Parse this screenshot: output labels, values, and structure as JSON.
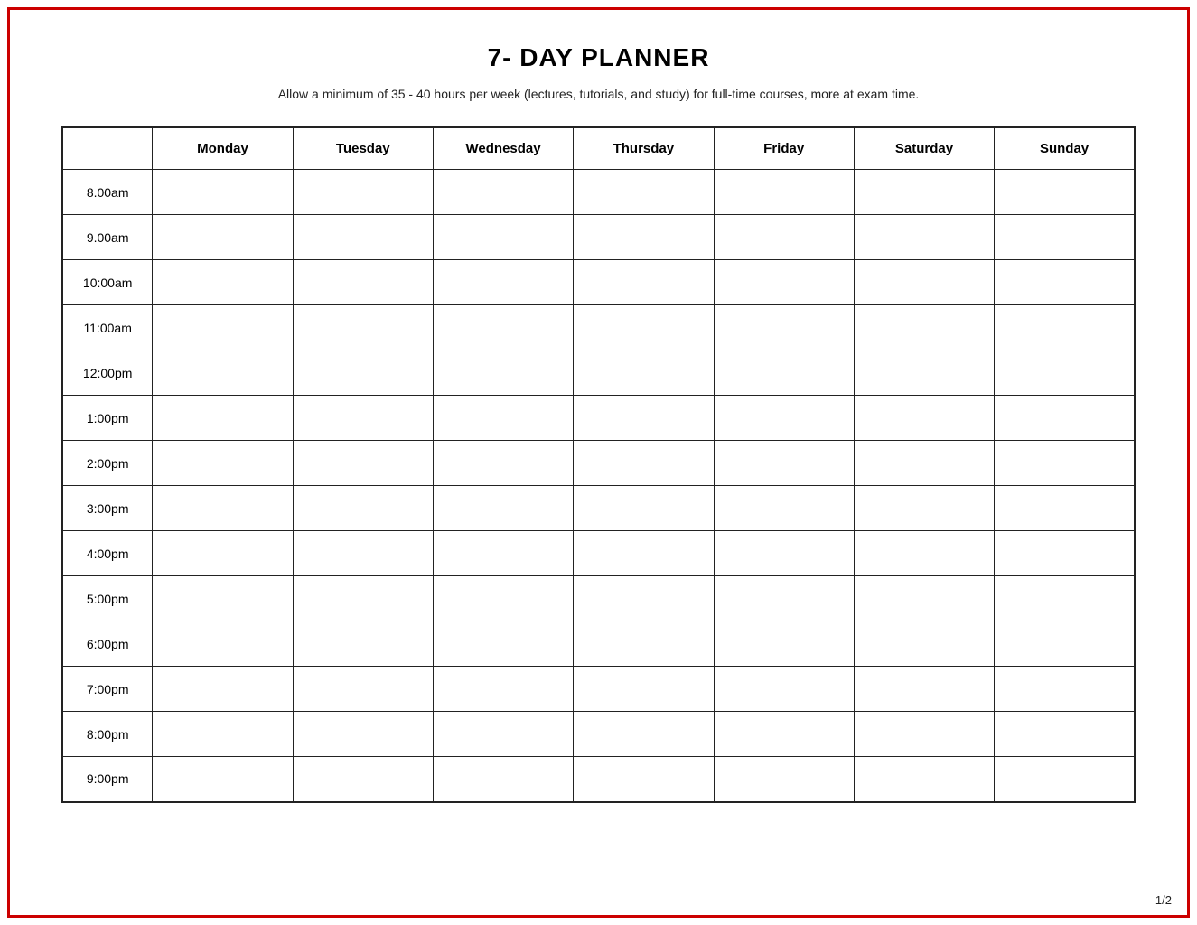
{
  "page": {
    "title": "7- DAY PLANNER",
    "subtitle": "Allow a minimum of 35 - 40 hours per week (lectures, tutorials, and study) for full-time courses, more at exam time.",
    "page_number": "1/2"
  },
  "table": {
    "columns": [
      "",
      "Monday",
      "Tuesday",
      "Wednesday",
      "Thursday",
      "Friday",
      "Saturday",
      "Sunday"
    ],
    "rows": [
      "8.00am",
      "9.00am",
      "10:00am",
      "11:00am",
      "12:00pm",
      "1:00pm",
      "2:00pm",
      "3:00pm",
      "4:00pm",
      "5:00pm",
      "6:00pm",
      "7:00pm",
      "8:00pm",
      "9:00pm"
    ]
  }
}
